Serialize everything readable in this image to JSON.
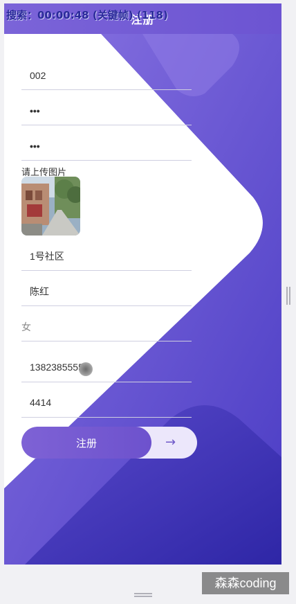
{
  "overlay": {
    "recording_text": "搜索：00:00:48 (关键帧) (118)"
  },
  "header": {
    "title": "注册",
    "back_icon": "back-chevron-icon"
  },
  "form": {
    "account": {
      "value": "002"
    },
    "password": {
      "value": "•••"
    },
    "confirm_password": {
      "value": "•••"
    },
    "upload_label": "请上传图片",
    "community": {
      "value": "1号社区"
    },
    "name": {
      "value": "陈红"
    },
    "gender": {
      "placeholder": "女"
    },
    "phone": {
      "value": "13823855551"
    },
    "code": {
      "value": "4414"
    },
    "submit_label": "注册",
    "submit_icon": "arrow-right-icon"
  },
  "watermark": {
    "text": "森森coding"
  },
  "colors": {
    "accent": "#6c54d2",
    "header": "#7b64d8",
    "deep": "#3a2fb0"
  }
}
